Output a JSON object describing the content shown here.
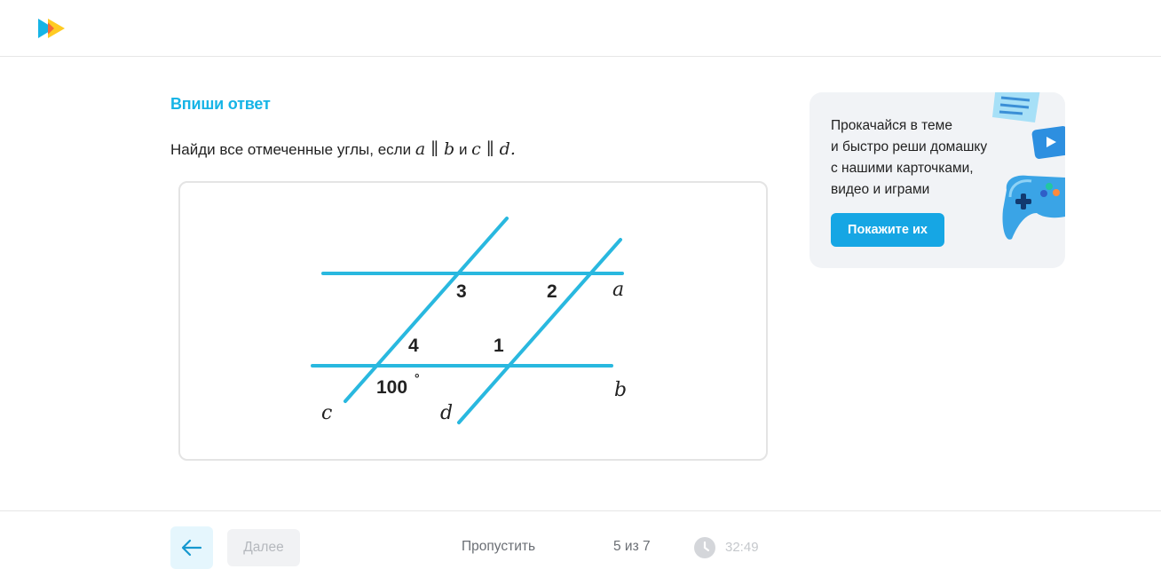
{
  "app": {
    "logo_icon": "play-logo-icon"
  },
  "task": {
    "type_label": "Впиши ответ",
    "prompt_prefix": "Найди все отмеченные углы, если",
    "condition_first": "a ∥ b",
    "conjunction": "и",
    "condition_second": "c ∥ d."
  },
  "figure": {
    "line_color": "#29b8df",
    "angle_labels": [
      "3",
      "2",
      "4",
      "1"
    ],
    "given_angle": "100",
    "degree_mark": "°",
    "line_labels": [
      "a",
      "b",
      "c",
      "d"
    ]
  },
  "promo": {
    "lines": [
      "Прокачайся в теме",
      "и быстро реши домашку",
      "с нашими карточками,",
      "видео и играми"
    ],
    "button_label": "Покажите их",
    "accent": "#16a6e4",
    "art_icons": [
      "notes-card-icon",
      "video-play-icon",
      "gamepad-icon"
    ]
  },
  "footer": {
    "back_icon": "arrow-left-icon",
    "next_label": "Далее",
    "skip_label": "Пропустить",
    "progress_text": "5 из 7",
    "timer_icon": "clock-icon",
    "timer_text": "32:49"
  }
}
